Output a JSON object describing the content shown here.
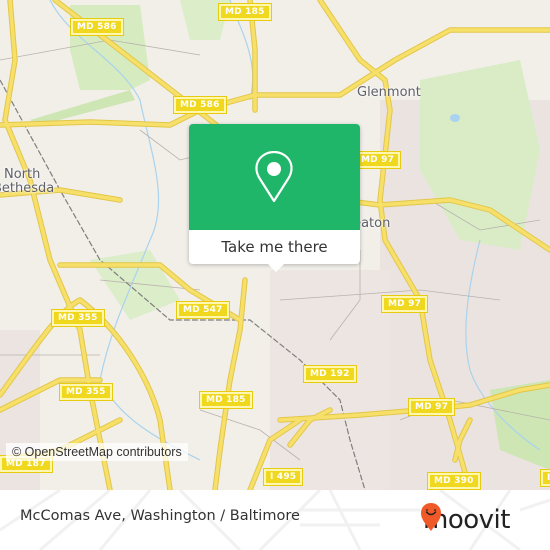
{
  "map": {
    "places": [
      {
        "id": "glenmont",
        "label": "Glenmont"
      },
      {
        "id": "north",
        "label": "North"
      },
      {
        "id": "bethesda",
        "label": "Bethesda"
      },
      {
        "id": "wheaton",
        "label": "Wheaton"
      }
    ],
    "shields": [
      {
        "label": "MD 586"
      },
      {
        "label": "MD 185"
      },
      {
        "label": "MD 586"
      },
      {
        "label": "MD 97"
      },
      {
        "label": "MD 547"
      },
      {
        "label": "MD 355"
      },
      {
        "label": "MD 97"
      },
      {
        "label": "MD 355"
      },
      {
        "label": "MD 185"
      },
      {
        "label": "MD 192"
      },
      {
        "label": "MD 97"
      },
      {
        "label": "MD 187"
      },
      {
        "label": "I 495"
      },
      {
        "label": "MD 390"
      },
      {
        "label": "I"
      }
    ],
    "attribution": "© OpenStreetMap contributors",
    "colors": {
      "road": "#f5dc5a",
      "park": "#d6ebbf",
      "water": "#a9d3ee",
      "background": "#f2efe9"
    }
  },
  "popup": {
    "button_label": "Take me there",
    "icon": "map-pin-icon",
    "color": "#20b66a"
  },
  "footer": {
    "address": "McComas Ave, Washington / Baltimore",
    "brand": "moovit",
    "brand_color": "#f05a28"
  }
}
